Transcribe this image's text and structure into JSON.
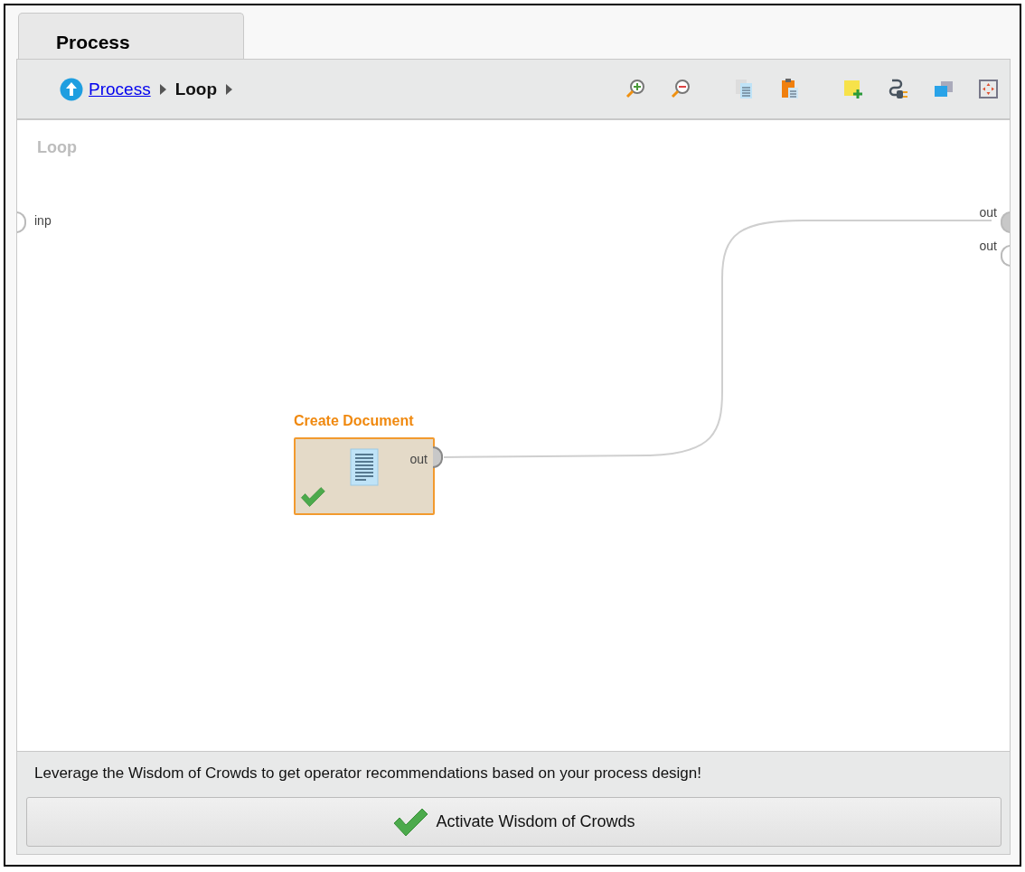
{
  "tab": {
    "label": "Process",
    "selected": true
  },
  "breadcrumb": [
    {
      "label": "Process",
      "kind": "link"
    },
    {
      "label": "Loop",
      "kind": "current"
    }
  ],
  "canvas": {
    "title": "Loop",
    "input_ports": [
      {
        "label": "inp",
        "connected": false
      }
    ],
    "output_ports": [
      {
        "label": "out",
        "connected": true
      },
      {
        "label": "out",
        "connected": false
      }
    ],
    "operators": [
      {
        "name": "Create Document",
        "executed": true,
        "ports": [
          {
            "label": "out",
            "connected": true
          }
        ]
      }
    ]
  },
  "recommendations": {
    "message": "Leverage the Wisdom of Crowds to get operator recommendations based on your process design!",
    "button": "Activate Wisdom of Crowds"
  }
}
